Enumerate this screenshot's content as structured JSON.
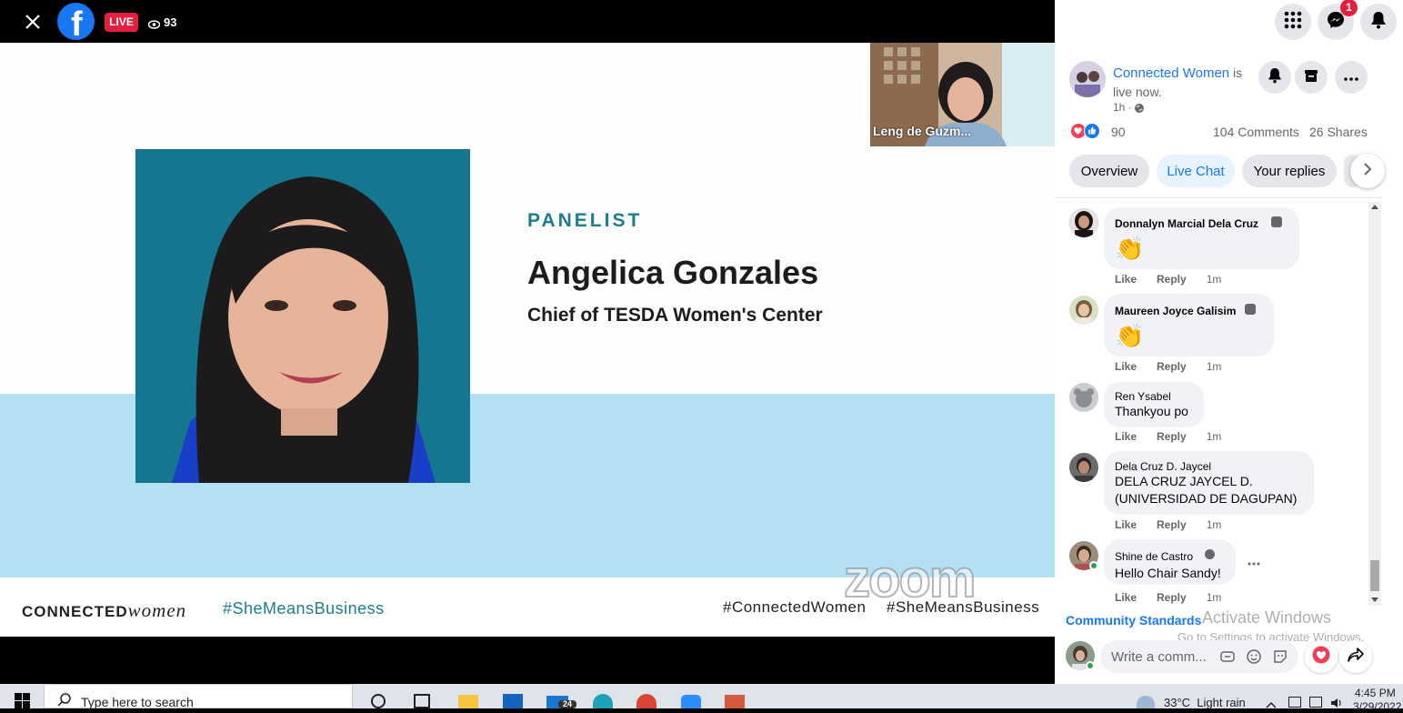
{
  "topbar": {
    "live_label": "LIVE",
    "viewer_count": "93"
  },
  "slide": {
    "role": "PANELIST",
    "name": "Angelica Gonzales",
    "title": "Chief of TESDA Women's Center",
    "brand_bold": "CONNECTED",
    "brand_italic": "women",
    "hashtag_left": "#SheMeansBusiness",
    "hashtag_right_1": "#ConnectedWomen",
    "hashtag_right_2": "#SheMeansBusiness",
    "zoom_watermark": "zoom"
  },
  "pip": {
    "name": "Leng de Guzm..."
  },
  "header": {
    "notification_badge": "1"
  },
  "post": {
    "page_name": "Connected Women",
    "status": "is live now.",
    "time": "1h ·",
    "reaction_count": "90",
    "comments": "104 Comments",
    "shares": "26 Shares"
  },
  "tabs": [
    {
      "label": "Overview"
    },
    {
      "label": "Live Chat"
    },
    {
      "label": "Your replies"
    }
  ],
  "comments": [
    {
      "name": "Donnalyn Marcial Dela Cruz",
      "text": "👏",
      "time": "1m"
    },
    {
      "name": "Maureen Joyce Galisim",
      "text": "👏",
      "time": "1m"
    },
    {
      "name": "Ren Ysabel",
      "text": "Thankyou po",
      "time": "1m"
    },
    {
      "name": "Dela Cruz D. Jaycel",
      "text": "DELA CRUZ JAYCEL D. (UNIVERSIDAD DE DAGUPAN)",
      "time": "1m"
    },
    {
      "name": "Shine de Castro",
      "text": "Hello Chair Sandy!",
      "time": "1m"
    }
  ],
  "actions": {
    "like": "Like",
    "reply": "Reply"
  },
  "community_standards": "Community Standards",
  "activate": {
    "line1": "Activate Windows",
    "line2": "Go to Settings to activate Windows."
  },
  "composer": {
    "placeholder": "Write a comm..."
  },
  "taskbar": {
    "search_placeholder": "Type here to search",
    "mail_badge": "24",
    "weather": "33°C  Light rain",
    "time": "4:45 PM",
    "date": "3/29/2022"
  },
  "colors": {
    "facebook_blue": "#1877f2",
    "live_red": "#e41e3f",
    "slide_teal": "#1e7d8c",
    "band_blue": "#b3e1f3"
  }
}
